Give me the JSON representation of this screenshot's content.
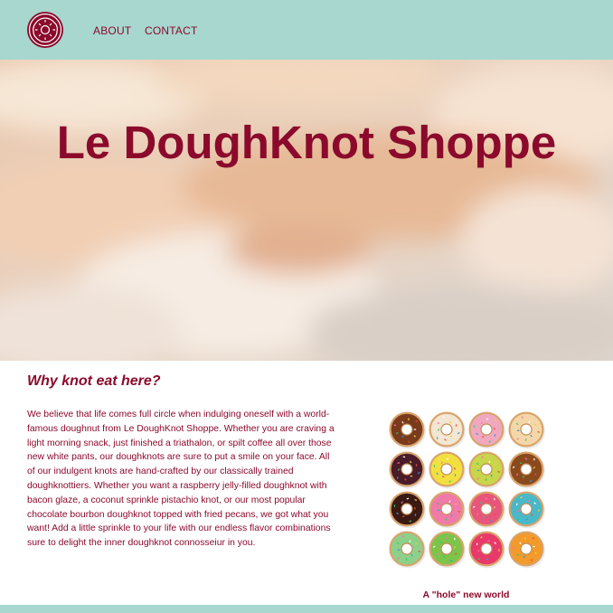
{
  "colors": {
    "accent": "#8b0a2c",
    "header_bg": "#a7d7cf",
    "page_bg": "#ffffff"
  },
  "header": {
    "logo_icon": "donut-logo-icon",
    "nav": [
      {
        "label": "ABOUT"
      },
      {
        "label": "CONTACT"
      }
    ]
  },
  "hero": {
    "title": "Le DoughKnot Shoppe"
  },
  "main": {
    "heading": "Why knot eat here?",
    "body": "We believe that life comes full circle when indulging oneself with a world-famous doughnut from Le DoughKnot Shoppe. Whether you are craving a light morning snack, just finished a triathalon, or spilt coffee all over those new white pants, our doughknots are sure to put a smile on your face. All of our indulgent knots are hand-crafted by our classically trained doughknottiers. Whether you want a raspberry jelly-filled doughknot with bacon glaze, a coconut sprinkle pistachio knot, or our most popular chocolate bourbon doughknot topped with fried pecans, we got what you want! Add a little sprinkle to your life with our endless flavor combinations sure to delight the inner doughknot connosseiur in you.",
    "image_caption": "A \"hole\" new world",
    "donut_grid_colors": [
      [
        "#7a3a1c",
        "#f3e6d2",
        "#f0a8c0",
        "#f4d7a8"
      ],
      [
        "#4a1c2a",
        "#f2e040",
        "#c7d64a",
        "#8a4a1e"
      ],
      [
        "#3c1a14",
        "#f07aa8",
        "#e8557c",
        "#4ab8c8"
      ],
      [
        "#8ed08a",
        "#7cc44a",
        "#e83a6a",
        "#f29a2a"
      ]
    ]
  }
}
